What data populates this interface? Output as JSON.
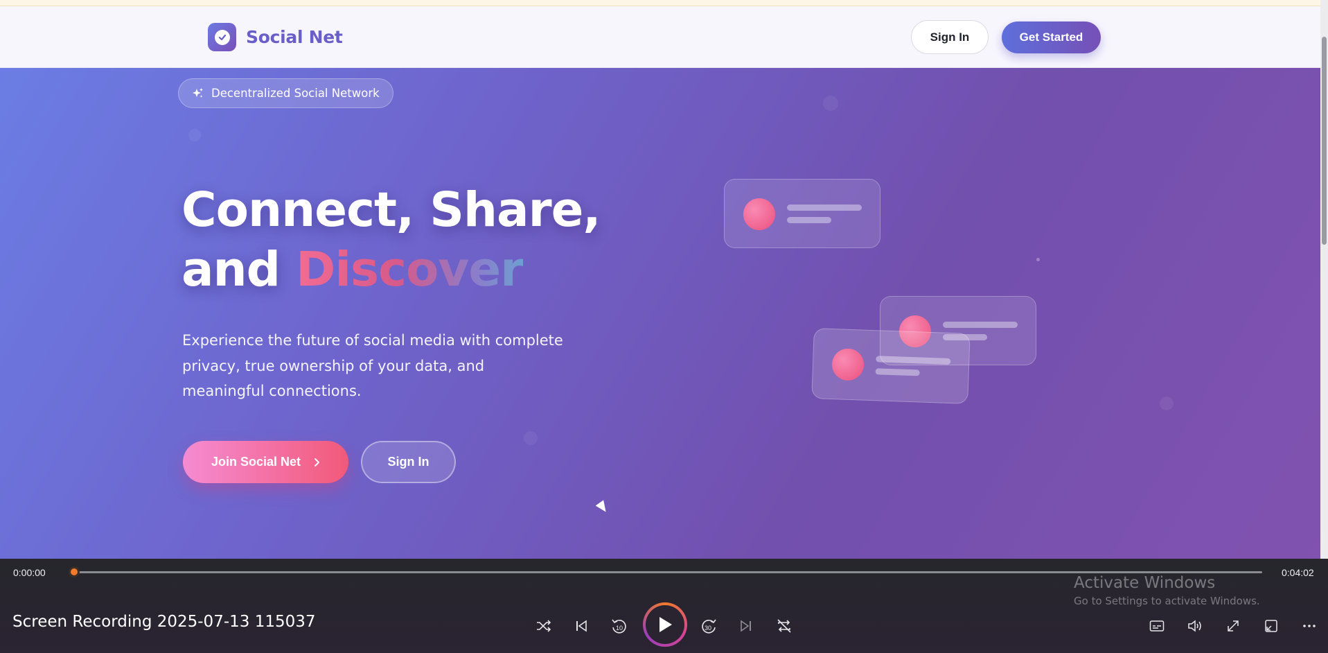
{
  "brand": {
    "name": "Social Net"
  },
  "nav": {
    "sign_in": "Sign In",
    "get_started": "Get Started"
  },
  "hero": {
    "badge": "Decentralized Social Network",
    "headline_line1": "Connect, Share,",
    "headline_and": "and",
    "headline_accent": "Discover",
    "lead": "Experience the future of social media with complete privacy, true ownership of your data, and meaningful connections.",
    "join_button": "Join Social Net",
    "sign_in_button": "Sign In"
  },
  "player": {
    "elapsed": "0:00:00",
    "duration": "0:04:02",
    "progress": 0.0,
    "title": "Screen Recording 2025-07-13 115037",
    "controls": [
      "shuffle-icon",
      "previous-icon",
      "rewind-10-icon",
      "play-icon",
      "forward-30-icon",
      "next-icon",
      "repeat-icon",
      "captions-icon",
      "volume-icon",
      "fullscreen-icon",
      "miniplayer-icon",
      "more-icon"
    ],
    "skip_back_label": "10",
    "skip_forward_label": "30"
  },
  "overlay": {
    "activate_title": "Activate Windows",
    "activate_sub": "Go to Settings to activate Windows."
  },
  "colors": {
    "brand": "#6a5fc8",
    "hero_start": "#6b7de4",
    "hero_end": "#8152b0",
    "join_gradient_start": "#f58bd2",
    "join_gradient_end": "#f2597a",
    "progress_knob": "#f17b2b"
  }
}
